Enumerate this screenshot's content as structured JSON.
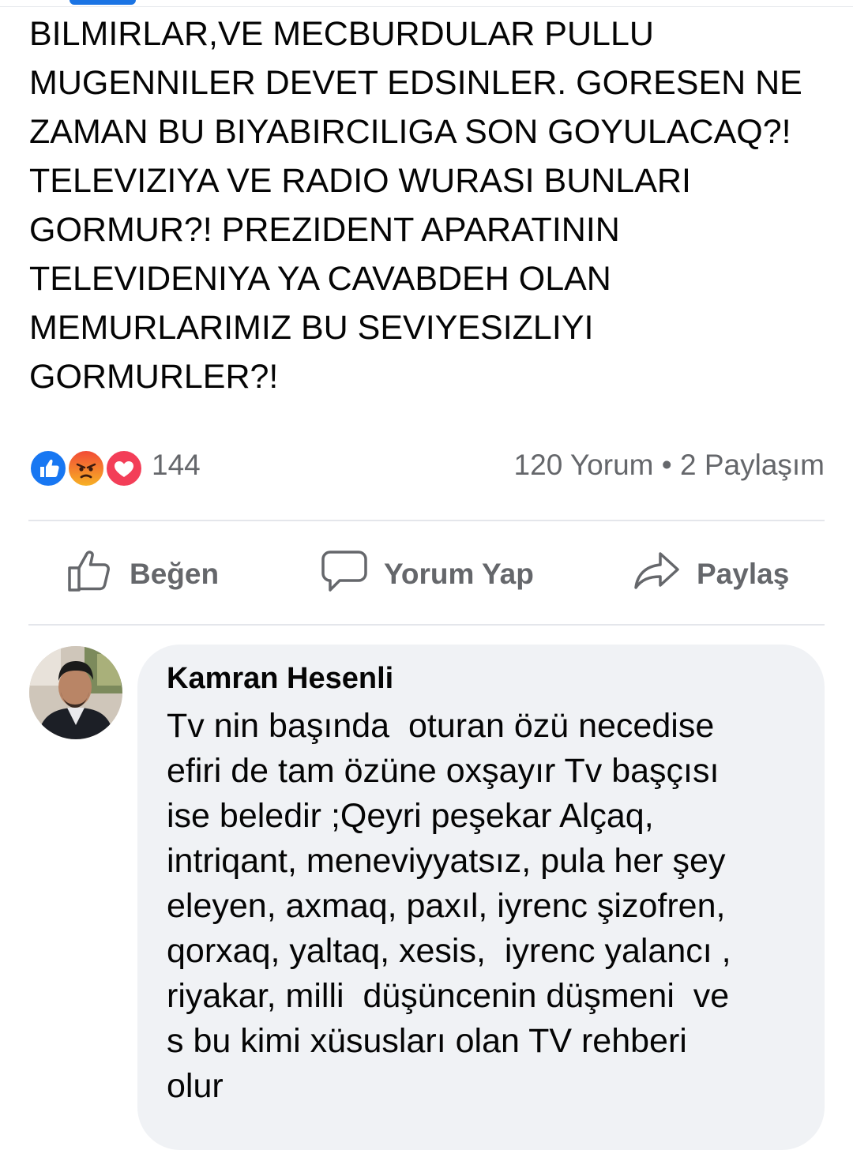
{
  "post": {
    "text": "BILMIRLAR,VE MECBURDULAR PULLU\nMUGENNILER DEVET EDSINLER. GORESEN NE\nZAMAN BU BIYABIRCILIGA SON GOYULACAQ?!\nTELEVIZIYA VE RADIO WURASI BUNLARI\nGORMUR?! PREZIDENT APARATININ\nTELEVIDENIYA YA CAVABDEH OLAN\nMEMURLARIMIZ BU SEVIYESIZLIYI\nGORMURLER?!"
  },
  "reactions": {
    "icons": [
      "like-reaction-icon",
      "angry-reaction-icon",
      "love-reaction-icon"
    ],
    "count": "144",
    "comments_shares": "120 Yorum • 2 Paylaşım"
  },
  "actions": {
    "like_label": "Beğen",
    "comment_label": "Yorum Yap",
    "share_label": "Paylaş"
  },
  "comment": {
    "author": "Kamran Hesenli",
    "text": "Tv nin başında  oturan özü necedise\nefiri de tam özüne oxşayır Tv başçısı\nise beledir ;Qeyri peşekar Alçaq,\nintriqant, meneviyyatsız, pula her şey\neleyen, axmaq, paxıl, iyrenc şizofren,\nqorxaq, yaltaq, xesis,  iyrenc yalancı ,\nriyakar, milli  düşüncenin düşmeni  ve\ns bu kimi xüsusları olan TV rehberi\nolur"
  },
  "colors": {
    "accent": "#1877f2",
    "secondary_text": "#65676b",
    "bubble_bg": "#f0f2f5",
    "divider": "#e4e6eb"
  }
}
